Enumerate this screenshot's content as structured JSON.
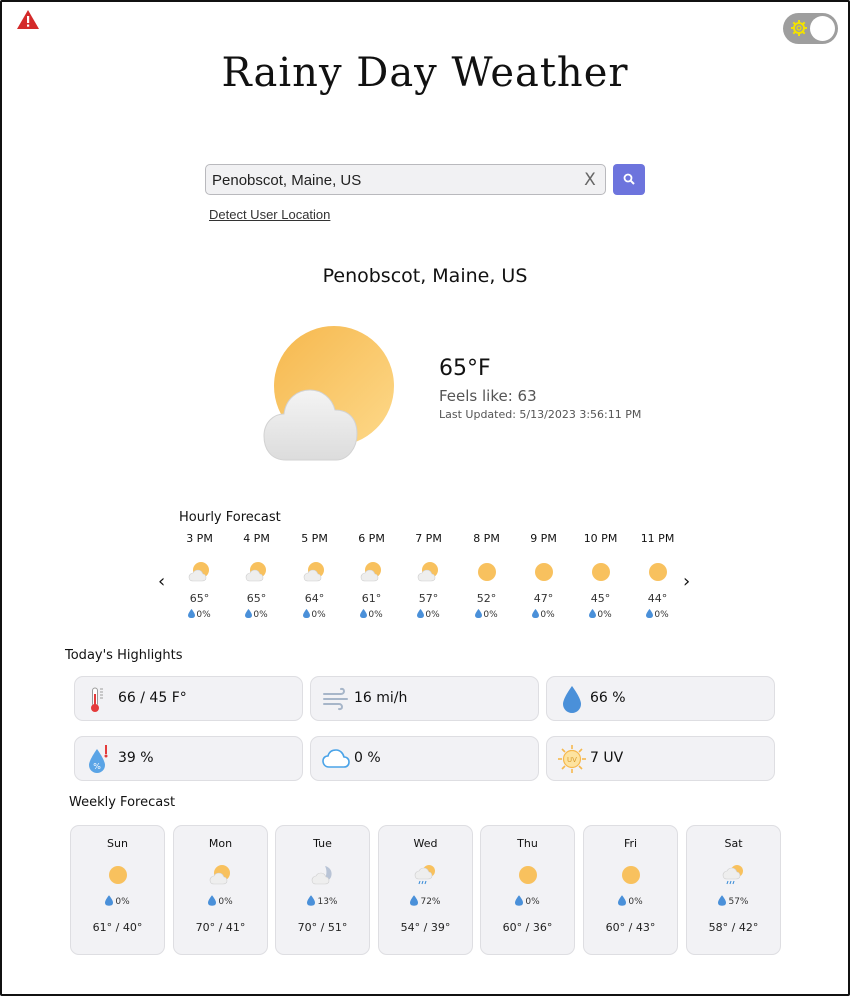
{
  "header": {
    "app_title": "Rainy Day Weather",
    "warning_icon": "warning-triangle-icon",
    "theme_toggle_icon": "gear-icon"
  },
  "search": {
    "value": "Penobscot, Maine, US",
    "clear_glyph": "X",
    "button_icon": "search-icon",
    "detect_link": "Detect User Location"
  },
  "current": {
    "location": "Penobscot, Maine, US",
    "temperature": "65°F",
    "feels_like": "Feels like: 63",
    "last_updated": "Last Updated: 5/13/2023 3:56:11 PM",
    "icon": "partly-cloudy-sun-icon"
  },
  "hourly": {
    "title": "Hourly Forecast",
    "prev_glyph": "‹",
    "next_glyph": "›",
    "items": [
      {
        "time": "3 PM",
        "temp": "65°",
        "rain": "0%",
        "icon": "partly-cloudy-icon"
      },
      {
        "time": "4 PM",
        "temp": "65°",
        "rain": "0%",
        "icon": "partly-cloudy-icon"
      },
      {
        "time": "5 PM",
        "temp": "64°",
        "rain": "0%",
        "icon": "partly-cloudy-icon"
      },
      {
        "time": "6 PM",
        "temp": "61°",
        "rain": "0%",
        "icon": "partly-cloudy-icon"
      },
      {
        "time": "7 PM",
        "temp": "57°",
        "rain": "0%",
        "icon": "partly-cloudy-icon"
      },
      {
        "time": "8 PM",
        "temp": "52°",
        "rain": "0%",
        "icon": "sun-icon"
      },
      {
        "time": "9 PM",
        "temp": "47°",
        "rain": "0%",
        "icon": "sun-icon"
      },
      {
        "time": "10 PM",
        "temp": "45°",
        "rain": "0%",
        "icon": "sun-icon"
      },
      {
        "time": "11 PM",
        "temp": "44°",
        "rain": "0%",
        "icon": "sun-icon"
      }
    ]
  },
  "highlights": {
    "title": "Today's Highlights",
    "items": [
      {
        "value": "66 / 45 F°",
        "icon": "thermometer-icon"
      },
      {
        "value": "16 mi/h",
        "icon": "wind-icon"
      },
      {
        "value": "66 %",
        "icon": "humidity-drop-icon"
      },
      {
        "value": "39 %",
        "icon": "dew-point-icon"
      },
      {
        "value": "0 %",
        "icon": "cloud-cover-icon"
      },
      {
        "value": "7 UV",
        "icon": "uv-index-icon"
      }
    ]
  },
  "weekly": {
    "title": "Weekly Forecast",
    "days": [
      {
        "day": "Sun",
        "rain": "0%",
        "temps": "61° / 40°",
        "icon": "sun-icon"
      },
      {
        "day": "Mon",
        "rain": "0%",
        "temps": "70° / 41°",
        "icon": "partly-cloudy-icon"
      },
      {
        "day": "Tue",
        "rain": "13%",
        "temps": "70° / 51°",
        "icon": "cloudy-moon-icon"
      },
      {
        "day": "Wed",
        "rain": "72%",
        "temps": "54° / 39°",
        "icon": "rain-icon"
      },
      {
        "day": "Thu",
        "rain": "0%",
        "temps": "60° / 36°",
        "icon": "sun-icon"
      },
      {
        "day": "Fri",
        "rain": "0%",
        "temps": "60° / 43°",
        "icon": "sun-icon"
      },
      {
        "day": "Sat",
        "rain": "57%",
        "temps": "58° / 42°",
        "icon": "rain-icon"
      }
    ]
  },
  "colors": {
    "accent": "#6d74dd",
    "sun": "#f8bf58",
    "drop": "#4a90d9",
    "card_bg": "#f2f2f5"
  }
}
